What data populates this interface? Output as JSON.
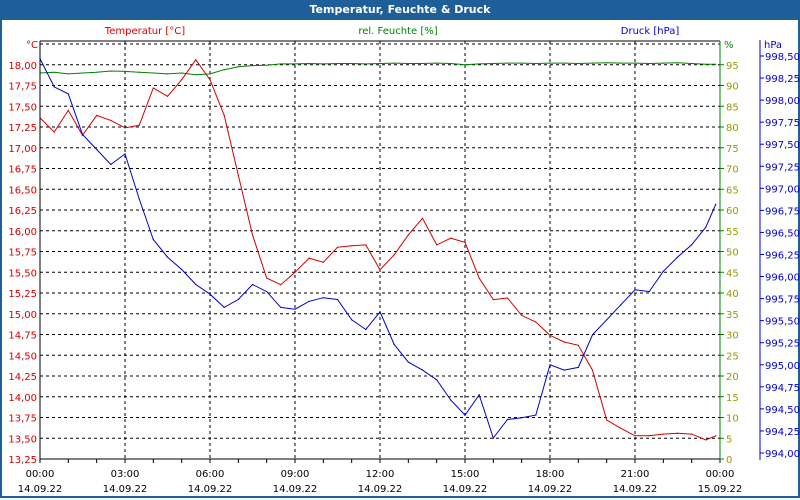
{
  "window": {
    "title": "Temperatur, Feuchte & Druck"
  },
  "chart_data": {
    "type": "line",
    "title": "Temperatur, Feuchte & Druck",
    "x_unit": "hours since 14.09.22 00:00",
    "x_ticks": [
      {
        "h": 0,
        "time": "00:00",
        "date": "14.09.22"
      },
      {
        "h": 3,
        "time": "03:00",
        "date": "14.09.22"
      },
      {
        "h": 6,
        "time": "06:00",
        "date": "14.09.22"
      },
      {
        "h": 9,
        "time": "09:00",
        "date": "14.09.22"
      },
      {
        "h": 12,
        "time": "12:00",
        "date": "14.09.22"
      },
      {
        "h": 15,
        "time": "15:00",
        "date": "14.09.22"
      },
      {
        "h": 18,
        "time": "18:00",
        "date": "14.09.22"
      },
      {
        "h": 21,
        "time": "21:00",
        "date": "14.09.22"
      },
      {
        "h": 24,
        "time": "00:00",
        "date": "15.09.22"
      }
    ],
    "xlim": [
      0,
      24
    ],
    "grid": true,
    "axes": {
      "temp": {
        "label": "Temperatur [°C]",
        "unit": "°C",
        "ylim": [
          13.25,
          18.25
        ],
        "step": 0.25,
        "decimals": 2,
        "color": "#d40000"
      },
      "hum": {
        "label": "rel. Feuchte [%]",
        "unit": "%",
        "ylim": [
          0,
          100
        ],
        "step": 5,
        "decimals": 0,
        "color": "#008000"
      },
      "press": {
        "label": "Druck [hPa]",
        "unit": "hPa",
        "ylim": [
          994.0,
          998.5
        ],
        "step": 0.25,
        "decimals": 2,
        "color": "#0000cc"
      }
    },
    "x": [
      0,
      0.5,
      1,
      1.5,
      2,
      2.5,
      3,
      3.5,
      4,
      4.5,
      5,
      5.5,
      6,
      6.5,
      7,
      7.5,
      8,
      8.5,
      9,
      9.5,
      10,
      10.5,
      11,
      11.5,
      12,
      12.5,
      13,
      13.5,
      14,
      14.5,
      15,
      15.5,
      16,
      16.5,
      17,
      17.5,
      18,
      18.5,
      19,
      19.5,
      20,
      20.5,
      21,
      21.5,
      22,
      22.5,
      23,
      23.5,
      23.85
    ],
    "series": [
      {
        "name": "Temperatur",
        "axis": "temp",
        "color": "#d40000",
        "values": [
          17.36,
          17.19,
          17.45,
          17.15,
          17.39,
          17.33,
          17.24,
          17.27,
          17.72,
          17.62,
          17.82,
          18.06,
          17.82,
          17.39,
          16.67,
          15.95,
          15.43,
          15.35,
          15.5,
          15.67,
          15.62,
          15.8,
          15.82,
          15.83,
          15.53,
          15.71,
          15.95,
          16.15,
          15.83,
          15.91,
          15.86,
          15.43,
          15.17,
          15.19,
          14.98,
          14.9,
          14.74,
          14.66,
          14.62,
          14.32,
          13.72,
          13.62,
          13.53,
          13.53,
          13.55,
          13.56,
          13.55,
          13.48,
          13.53
        ]
      },
      {
        "name": "rel. Feuchte",
        "axis": "hum",
        "color": "#008000",
        "values": [
          93.0,
          93.2,
          92.8,
          93.0,
          93.2,
          93.5,
          93.4,
          93.2,
          93.0,
          92.8,
          93.0,
          92.6,
          92.8,
          93.8,
          94.5,
          94.8,
          94.9,
          95.2,
          95.2,
          95.3,
          95.2,
          95.3,
          95.3,
          95.2,
          95.3,
          95.4,
          95.3,
          95.3,
          95.4,
          95.3,
          95.0,
          95.2,
          95.3,
          95.4,
          95.4,
          95.3,
          95.4,
          95.4,
          95.3,
          95.4,
          95.5,
          95.4,
          95.4,
          95.3,
          95.4,
          95.5,
          95.3,
          95.1,
          95.1
        ]
      },
      {
        "name": "Druck",
        "axis": "press",
        "color": "#0000cc",
        "values": [
          998.47,
          998.15,
          998.07,
          997.61,
          997.44,
          997.27,
          997.39,
          996.88,
          996.42,
          996.22,
          996.08,
          995.91,
          995.8,
          995.65,
          995.74,
          995.91,
          995.83,
          995.65,
          995.63,
          995.72,
          995.76,
          995.74,
          995.51,
          995.4,
          995.6,
          995.23,
          995.03,
          994.94,
          994.83,
          994.6,
          994.43,
          994.66,
          994.17,
          994.38,
          994.4,
          994.43,
          995.0,
          994.94,
          994.97,
          995.34,
          995.51,
          995.68,
          995.85,
          995.83,
          996.06,
          996.22,
          996.36,
          996.56,
          996.82
        ]
      }
    ]
  }
}
